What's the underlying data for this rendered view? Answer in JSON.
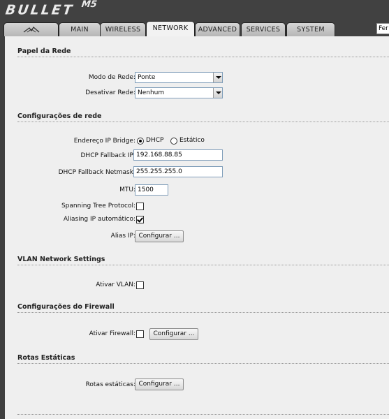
{
  "brand": {
    "logo": "BULLET",
    "logo_model": "M5",
    "colors": {
      "header": "#414141",
      "panel": "#efefef"
    }
  },
  "tabs": [
    {
      "label": "",
      "icon": "ubiquiti-logo-icon"
    },
    {
      "label": "MAIN"
    },
    {
      "label": "WIRELESS"
    },
    {
      "label": "NETWORK",
      "active": true
    },
    {
      "label": "ADVANCED"
    },
    {
      "label": "SERVICES"
    },
    {
      "label": "SYSTEM"
    }
  ],
  "tools_select": {
    "value": "Fer"
  },
  "sections": {
    "network_role": {
      "title": "Papel da Rede",
      "network_mode_label": "Modo de Rede:",
      "network_mode_value": "Ponte",
      "disable_network_label": "Desativar Rede:",
      "disable_network_value": "Nenhum"
    },
    "network_settings": {
      "title": "Configurações de rede",
      "bridge_ip_label": "Endereço IP Bridge:",
      "dhcp_label": "DHCP",
      "static_label": "Estático",
      "bridge_ip_mode": "DHCP",
      "fallback_ip_label": "DHCP Fallback IP:",
      "fallback_ip_value": "192.168.88.85",
      "fallback_netmask_label": "DHCP Fallback Netmask:",
      "fallback_netmask_value": "255.255.255.0",
      "mtu_label": "MTU:",
      "mtu_value": "1500",
      "stp_label": "Spanning Tree Protocol:",
      "stp_checked": false,
      "auto_ip_aliasing_label": "Aliasing IP automático:",
      "auto_ip_aliasing_checked": true,
      "ip_alias_label": "Alias IP:",
      "ip_alias_button": "Configurar ..."
    },
    "vlan": {
      "title": "VLAN Network Settings",
      "enable_vlan_label": "Ativar VLAN:",
      "enable_vlan_checked": false
    },
    "firewall": {
      "title": "Configurações do Firewall",
      "enable_firewall_label": "Ativar Firewall:",
      "enable_firewall_checked": false,
      "configure_button": "Configurar ..."
    },
    "static_routes": {
      "title": "Rotas Estáticas",
      "static_routes_label": "Rotas estáticas:",
      "configure_button": "Configurar ..."
    }
  }
}
